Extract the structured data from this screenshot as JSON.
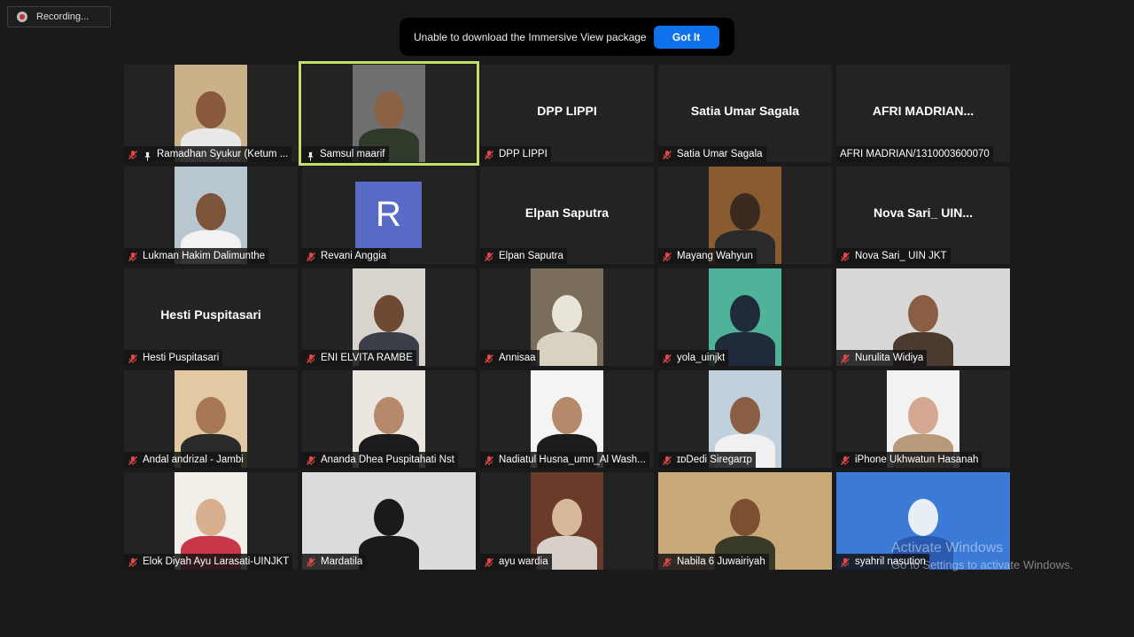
{
  "recording": {
    "label": "Recording..."
  },
  "notice": {
    "message": "Unable to download the Immersive View package",
    "button": "Got It"
  },
  "watermark": {
    "line1": "Activate Windows",
    "line2": "Go to Settings to activate Windows."
  },
  "participants": [
    {
      "name": "Ramadhan Syukur (Ketum ...",
      "pinned": true,
      "muted": true,
      "view": "video",
      "bg": "#c9b18a",
      "shirt": "#e8e8e8",
      "skin": "#8a5a3c"
    },
    {
      "name": "Samsul maarif",
      "pinned": true,
      "muted": false,
      "view": "video",
      "active": true,
      "bg": "#6f6f6f",
      "shirt": "#2f3a2a",
      "skin": "#8c6244"
    },
    {
      "name": "DPP LIPPI",
      "display": "DPP LIPPI",
      "muted": true,
      "view": "name"
    },
    {
      "name": "Satia Umar Sagala",
      "display": "Satia Umar Sagala",
      "muted": true,
      "view": "name"
    },
    {
      "name": "AFRI MADRIAN/1310003600070",
      "display": "AFRI MADRIAN...",
      "muted": false,
      "view": "name"
    },
    {
      "name": "Lukman Hakim Dalimunthe",
      "muted": true,
      "view": "video",
      "bg": "#b8c6cf",
      "shirt": "#f2f2f2",
      "skin": "#7b543a"
    },
    {
      "name": "Revani Anggia",
      "muted": true,
      "view": "avatar",
      "avatar_letter": "R",
      "avatar_color": "#5a6bc7"
    },
    {
      "name": "Elpan Saputra",
      "display": "Elpan Saputra",
      "muted": true,
      "view": "name"
    },
    {
      "name": "Mayang Wahyun",
      "muted": true,
      "view": "video",
      "bg": "#8a5a30",
      "shirt": "#2a2a2a",
      "skin": "#3a2a20"
    },
    {
      "name": "Nova Sari_ UIN JKT",
      "display": "Nova Sari_ UIN...",
      "muted": true,
      "view": "name"
    },
    {
      "name": "Hesti Puspitasari",
      "display": "Hesti Puspitasari",
      "muted": true,
      "view": "name"
    },
    {
      "name": "ENI ELVITA RAMBE",
      "muted": true,
      "view": "video",
      "bg": "#d8d3cc",
      "shirt": "#3b3f48",
      "skin": "#6e4a34"
    },
    {
      "name": "Annisaa",
      "muted": true,
      "view": "video",
      "bg": "#7a6e5a",
      "shirt": "#d9d2c2",
      "skin": "#e9e4d8"
    },
    {
      "name": "yola_uinjkt",
      "muted": true,
      "view": "video",
      "bg": "#4fb39a",
      "shirt": "#1f2b3a",
      "skin": "#1f2b3a"
    },
    {
      "name": "Nurulita Widiya",
      "muted": true,
      "view": "video",
      "wide": true,
      "bg": "#d8d8d8",
      "shirt": "#4a3a30",
      "skin": "#8a5e44"
    },
    {
      "name": "Andal andrizal - Jambi",
      "muted": true,
      "view": "video",
      "bg": "#e2c9a3",
      "shirt": "#2a2a2a",
      "skin": "#a67856"
    },
    {
      "name": "Ananda Dhea Puspitahati Nst",
      "muted": true,
      "view": "video",
      "bg": "#ece6e0",
      "shirt": "#1c1c1c",
      "skin": "#b48a6a"
    },
    {
      "name": "Nadiatul Husna_umn_Al Wash...",
      "muted": true,
      "view": "video",
      "bg": "#f4f4f4",
      "shirt": "#1c1c1c",
      "skin": "#b48a6a"
    },
    {
      "name": "ɪᴅDedi Siregarɪp",
      "muted": true,
      "view": "video",
      "bg": "#c0d0dc",
      "shirt": "#f0f0f0",
      "skin": "#8a5e44"
    },
    {
      "name": "iPhone Ukhwatun Hasanah",
      "muted": true,
      "view": "video",
      "bg": "#f2f2f0",
      "shirt": "#b89a7a",
      "skin": "#d4a890"
    },
    {
      "name": "Elok Diyah Ayu Larasati-UINJKT",
      "muted": true,
      "view": "video",
      "bg": "#f2eee8",
      "shirt": "#c8384a",
      "skin": "#d8b090"
    },
    {
      "name": "Mardatila",
      "muted": true,
      "view": "video",
      "wide": true,
      "bg": "#dcdcdc",
      "shirt": "#1a1a1a",
      "skin": "#1a1a1a"
    },
    {
      "name": "ayu wardia",
      "muted": true,
      "view": "video",
      "bg": "#6a3a2a",
      "shirt": "#d8d0c8",
      "skin": "#d8b89a"
    },
    {
      "name": "Nabila 6 Juwairiyah",
      "muted": true,
      "view": "video",
      "wide": true,
      "bg": "#c9a87a",
      "shirt": "#3a3a2a",
      "skin": "#7a5030"
    },
    {
      "name": "syahril nasution",
      "muted": true,
      "view": "video",
      "wide": true,
      "bg": "#3c7ad8",
      "shirt": "#2a5ab0",
      "skin": "#e8eef6"
    }
  ]
}
